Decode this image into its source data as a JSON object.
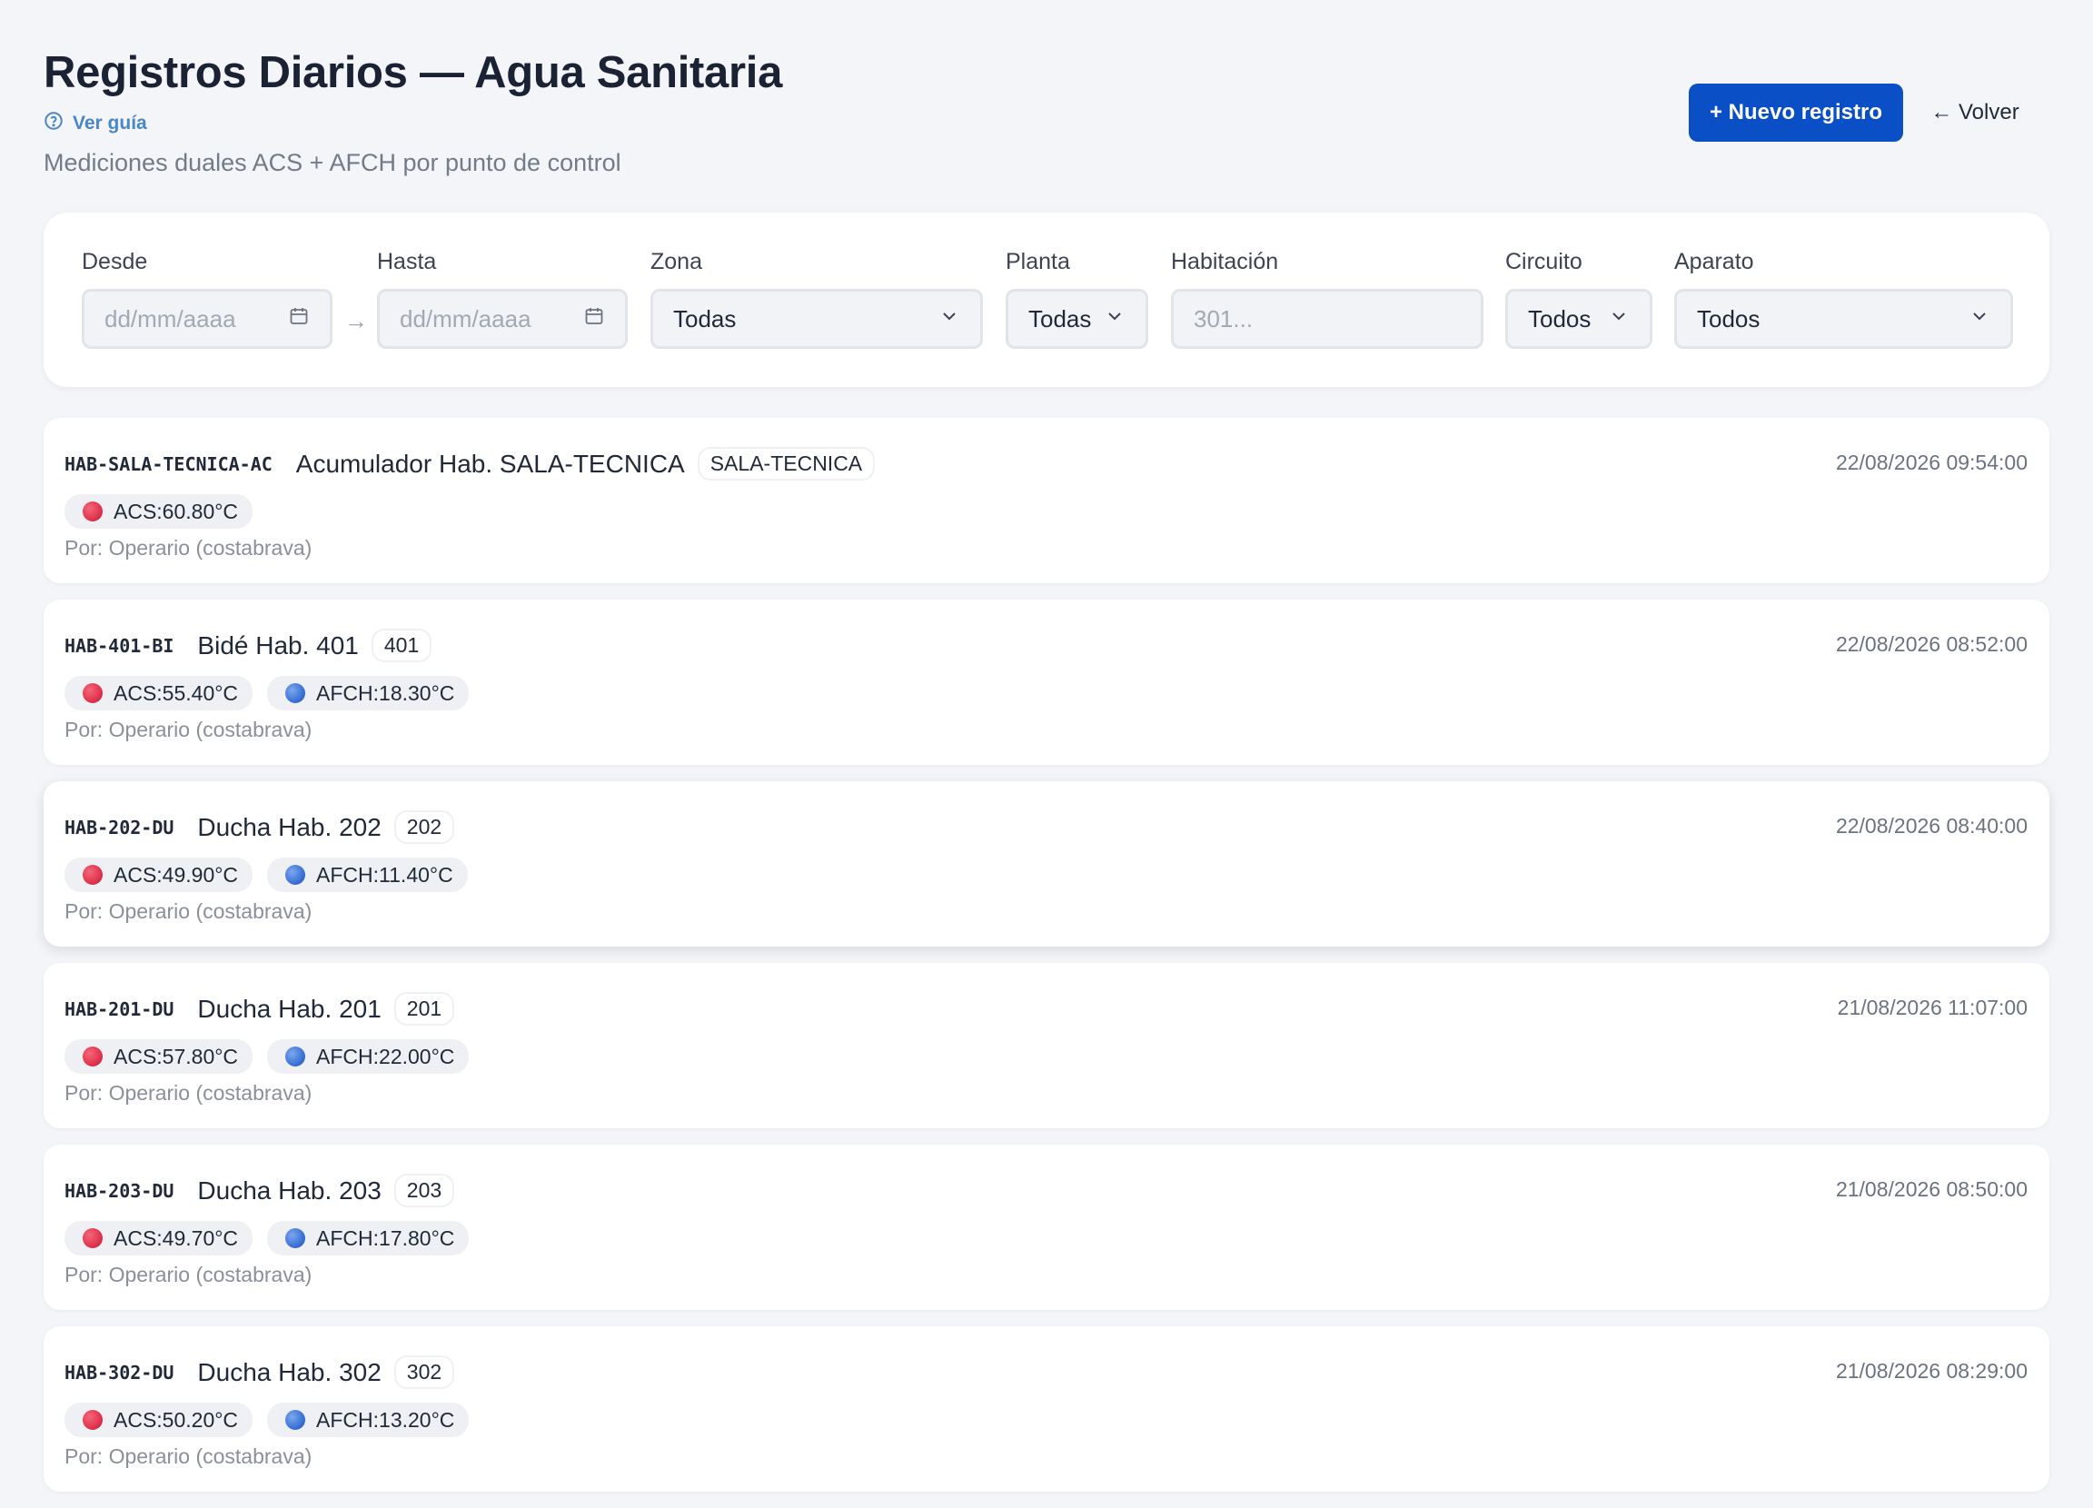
{
  "header": {
    "title": "Registros Diarios — Agua Sanitaria",
    "guide_label": "Ver guía",
    "subtitle": "Mediciones duales ACS + AFCH por punto de control",
    "new_label": "+ Nuevo registro",
    "back_label": "← Volver"
  },
  "filters": {
    "desde": {
      "label": "Desde",
      "placeholder": "dd/mm/aaaa"
    },
    "hasta": {
      "label": "Hasta",
      "placeholder": "dd/mm/aaaa"
    },
    "separator": "→",
    "zona": {
      "label": "Zona",
      "value": "Todas"
    },
    "planta": {
      "label": "Planta",
      "value": "Todas"
    },
    "habitacion": {
      "label": "Habitación",
      "placeholder": "301..."
    },
    "circuito": {
      "label": "Circuito",
      "value": "Todos"
    },
    "aparato": {
      "label": "Aparato",
      "value": "Todos"
    }
  },
  "colors": {
    "primary": "#0a4fc6",
    "link": "#4a86c8",
    "acs_dot": "#e0344c",
    "afch_dot": "#3a73d6"
  },
  "records": [
    {
      "code": "HAB-SALA-TECNICA-AC",
      "name": "Acumulador Hab. SALA-TECNICA",
      "tag": "SALA-TECNICA",
      "date": "22/08/2026 09:54:00",
      "acs": "ACS:60.80°C",
      "afch": null,
      "by": "Por: Operario (costabrava)"
    },
    {
      "code": "HAB-401-BI",
      "name": "Bidé Hab. 401",
      "tag": "401",
      "date": "22/08/2026 08:52:00",
      "acs": "ACS:55.40°C",
      "afch": "AFCH:18.30°C",
      "by": "Por: Operario (costabrava)"
    },
    {
      "code": "HAB-202-DU",
      "name": "Ducha Hab. 202",
      "tag": "202",
      "date": "22/08/2026 08:40:00",
      "acs": "ACS:49.90°C",
      "afch": "AFCH:11.40°C",
      "by": "Por: Operario (costabrava)"
    },
    {
      "code": "HAB-201-DU",
      "name": "Ducha Hab. 201",
      "tag": "201",
      "date": "21/08/2026 11:07:00",
      "acs": "ACS:57.80°C",
      "afch": "AFCH:22.00°C",
      "by": "Por: Operario (costabrava)"
    },
    {
      "code": "HAB-203-DU",
      "name": "Ducha Hab. 203",
      "tag": "203",
      "date": "21/08/2026 08:50:00",
      "acs": "ACS:49.70°C",
      "afch": "AFCH:17.80°C",
      "by": "Por: Operario (costabrava)"
    },
    {
      "code": "HAB-302-DU",
      "name": "Ducha Hab. 302",
      "tag": "302",
      "date": "21/08/2026 08:29:00",
      "acs": "ACS:50.20°C",
      "afch": "AFCH:13.20°C",
      "by": "Por: Operario (costabrava)"
    }
  ]
}
